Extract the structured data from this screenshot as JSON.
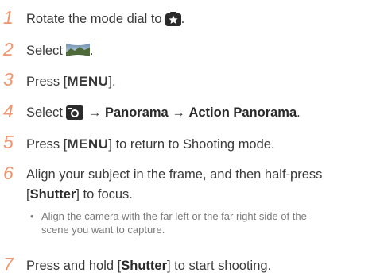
{
  "steps": [
    {
      "num": "1",
      "text": "Rotate the mode dial to",
      "end": ".",
      "icon": "scene-mode-icon"
    },
    {
      "num": "2",
      "text": "Select",
      "end": ".",
      "icon": "panorama-icon"
    },
    {
      "num": "3",
      "pre": "Press [",
      "menu": "MENU",
      "post": "]."
    },
    {
      "num": "4",
      "pre": "Select",
      "arrow1": "→",
      "b1": "Panorama",
      "arrow2": "→",
      "b2": "Action Panorama",
      "end": ".",
      "icon": "camera-icon"
    },
    {
      "num": "5",
      "pre": "Press [",
      "menu": "MENU",
      "post": "] to return to Shooting mode."
    },
    {
      "num": "6",
      "line1": "Align your subject in the frame, and then half-press",
      "pre2": "[",
      "b": "Shutter",
      "post2": "] to focus."
    },
    {
      "num": "7",
      "pre": "Press and hold [",
      "b": "Shutter",
      "post": "] to start shooting."
    }
  ],
  "note": {
    "bullet": "•",
    "line1": "Align the camera with the far left or the far right side of the",
    "line2": "scene you want to capture."
  },
  "colors": {
    "number": "#f0956f",
    "text": "#3a3a3a",
    "note": "#7a7a7a"
  }
}
